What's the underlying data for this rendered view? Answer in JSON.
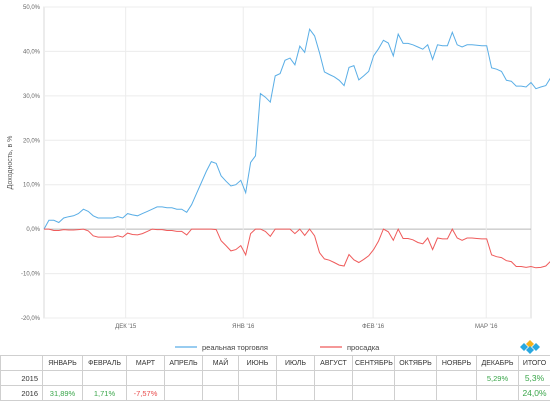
{
  "chart_data": {
    "type": "line",
    "ylabel": "Доходность, в %",
    "ylim": [
      -20,
      50
    ],
    "yticks": [
      -20,
      -10,
      0,
      10,
      20,
      30,
      40,
      50
    ],
    "ytick_labels": [
      "-20,0%",
      "-10,0%",
      "0,0%",
      "10,0%",
      "20,0%",
      "30,0%",
      "40,0%",
      "50,0%"
    ],
    "x_count": 100,
    "xticks": [
      {
        "i": 16.6,
        "label": "ДЕК '15"
      },
      {
        "i": 40.5,
        "label": "ЯНВ '16"
      },
      {
        "i": 66.9,
        "label": "ФЕВ '16"
      },
      {
        "i": 89.9,
        "label": "МАР '16"
      }
    ],
    "grid": true,
    "legend_position": "bottom",
    "series": [
      {
        "name": "реальная торговля",
        "color": "#5aaee6",
        "values": [
          0.0,
          2.0,
          2.0,
          1.5,
          2.5,
          2.8,
          3.0,
          3.5,
          4.5,
          4.0,
          3.0,
          2.5,
          2.5,
          2.5,
          2.5,
          2.8,
          2.5,
          3.5,
          3.2,
          3.0,
          3.5,
          4.0,
          4.5,
          5.0,
          5.0,
          4.8,
          4.8,
          4.5,
          4.5,
          3.8,
          5.5,
          8.0,
          10.5,
          13.0,
          15.2,
          14.8,
          12.0,
          10.8,
          9.7,
          10.0,
          11.0,
          8.2,
          15.0,
          16.5,
          30.5,
          29.7,
          28.6,
          34.5,
          35.0,
          38.0,
          38.5,
          37.0,
          41.2,
          39.8,
          45.0,
          43.5,
          39.7,
          35.4,
          34.8,
          34.3,
          33.5,
          32.3,
          36.4,
          36.8,
          33.6,
          34.5,
          35.5,
          39.0,
          40.6,
          42.5,
          41.9,
          39.0,
          43.9,
          41.8,
          41.8,
          41.5,
          41.0,
          40.5,
          41.5,
          38.2,
          41.5,
          41.3,
          41.3,
          44.3,
          41.5,
          41.0,
          41.5,
          41.5,
          41.4,
          41.3,
          41.3,
          36.3,
          36.0,
          35.5,
          33.5,
          33.3,
          32.2,
          32.2,
          32.0,
          33.0,
          31.6,
          32.0,
          32.3,
          34.1,
          33.6,
          30.5
        ]
      },
      {
        "name": "просадка",
        "color": "#ef5b5b",
        "values": [
          0.0,
          0.0,
          -0.3,
          -0.3,
          -0.1,
          -0.2,
          -0.2,
          -0.1,
          0.0,
          -0.4,
          -1.5,
          -1.8,
          -1.8,
          -1.8,
          -1.8,
          -1.5,
          -1.8,
          -0.9,
          -1.2,
          -1.3,
          -1.0,
          -0.5,
          0.0,
          -0.1,
          -0.1,
          -0.3,
          -0.3,
          -0.5,
          -0.5,
          -1.3,
          0.0,
          0.0,
          0.0,
          0.0,
          0.0,
          -0.1,
          -2.6,
          -3.7,
          -4.9,
          -4.6,
          -3.7,
          -5.8,
          -1.0,
          0.0,
          0.0,
          -0.5,
          -1.6,
          0.0,
          0.0,
          0.0,
          0.0,
          -1.0,
          0.0,
          -1.4,
          0.0,
          -1.5,
          -5.3,
          -6.7,
          -7.0,
          -7.5,
          -8.1,
          -8.3,
          -5.7,
          -6.9,
          -7.5,
          -6.8,
          -6.0,
          -4.6,
          -2.7,
          0.0,
          -0.6,
          -2.5,
          0.0,
          -2.1,
          -2.1,
          -2.4,
          -3.0,
          -3.3,
          -2.0,
          -4.6,
          -2.0,
          -2.2,
          -2.2,
          0.0,
          -2.0,
          -2.5,
          -2.0,
          -2.0,
          -2.1,
          -2.2,
          -2.2,
          -5.8,
          -6.2,
          -6.4,
          -7.1,
          -7.3,
          -8.4,
          -8.4,
          -8.6,
          -8.4,
          -8.7,
          -8.6,
          -8.3,
          -7.2,
          -7.6,
          -10.0
        ]
      }
    ]
  },
  "table": {
    "headers": [
      "",
      "ЯНВАРЬ",
      "ФЕВРАЛЬ",
      "МАРТ",
      "АПРЕЛЬ",
      "МАЙ",
      "ИЮНЬ",
      "ИЮЛЬ",
      "АВГУСТ",
      "СЕНТЯБРЬ",
      "ОКТЯБРЬ",
      "НОЯБРЬ",
      "ДЕКАБРЬ",
      "ИТОГО"
    ],
    "rows": [
      {
        "cells": [
          "2015",
          "",
          "",
          "",
          "",
          "",
          "",
          "",
          "",
          "",
          "",
          "",
          "5,29%",
          "5,3%"
        ]
      },
      {
        "cells": [
          "2016",
          "31,89%",
          "1,71%",
          "-7,57%",
          "",
          "",
          "",
          "",
          "",
          "",
          "",
          "",
          "",
          "24,0%"
        ]
      }
    ]
  },
  "logo_colors": [
    "#29a8e0",
    "#f6b21c",
    "#e94e3c",
    "#8bc34a"
  ]
}
